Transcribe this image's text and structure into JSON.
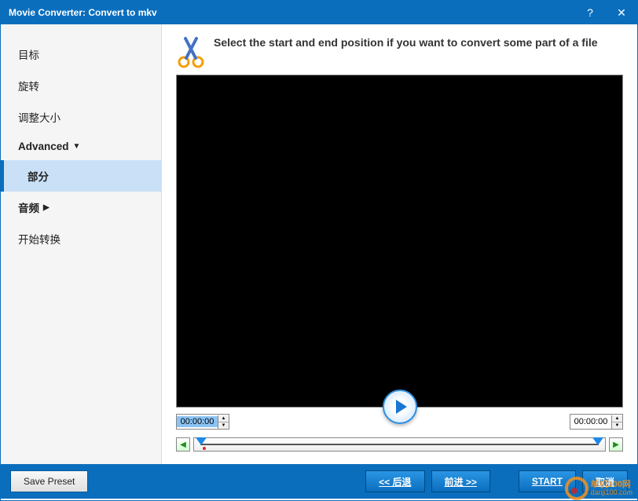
{
  "titlebar": {
    "title": "Movie Converter:  Convert to mkv",
    "help": "?",
    "close": "✕"
  },
  "sidebar": {
    "items": [
      {
        "label": "目标"
      },
      {
        "label": "旋转"
      },
      {
        "label": "调整大小"
      },
      {
        "label": "Advanced",
        "bold": true,
        "chev": "▼"
      },
      {
        "label": "部分",
        "active": true
      },
      {
        "label": "音频",
        "bold": true,
        "chev": "▶"
      },
      {
        "label": "开始转换"
      }
    ]
  },
  "hint": "Select the start and end position if you want to convert some part of a file",
  "times": {
    "start": "00:00:00",
    "end": "00:00:00"
  },
  "footer": {
    "save_preset": "Save Preset",
    "back": "<<  后退",
    "forward": "前进  >>",
    "start": "START",
    "cancel": "取消"
  },
  "watermark": {
    "line1": "单机100网",
    "line2": "danji100.com"
  }
}
